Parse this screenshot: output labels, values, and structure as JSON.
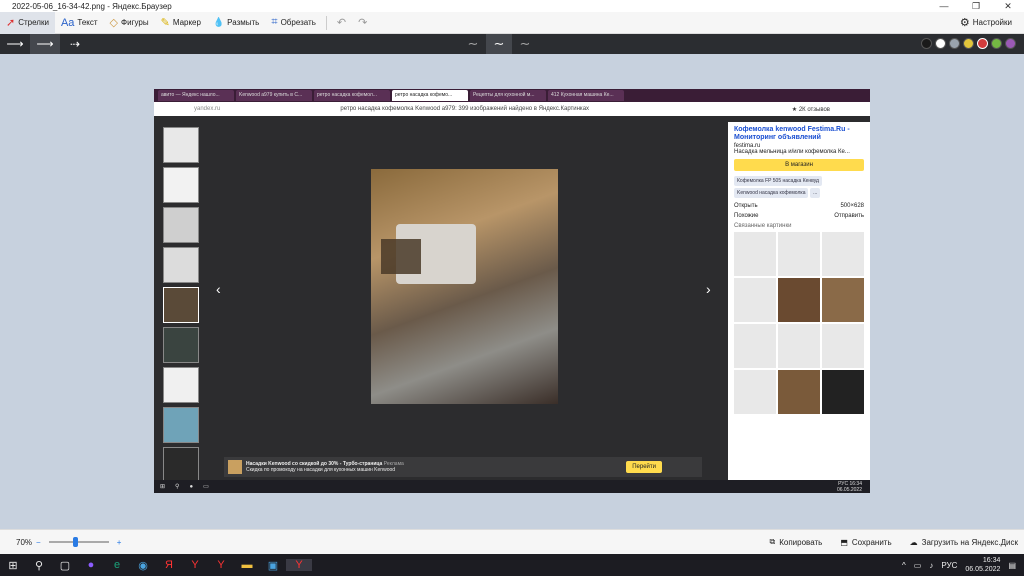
{
  "window": {
    "title": "2022-05-06_16-34-42.png - Яндекс.Браузер",
    "minimize_icon": "—",
    "maximize_icon": "❐",
    "close_icon": "✕"
  },
  "toolbar": {
    "tools": [
      {
        "label": "Стрелки",
        "icon": "➚"
      },
      {
        "label": "Текст",
        "icon": "Aa"
      },
      {
        "label": "Фигуры",
        "icon": "◇"
      },
      {
        "label": "Маркер",
        "icon": "✎"
      },
      {
        "label": "Размыть",
        "icon": "💧"
      },
      {
        "label": "Обрезать",
        "icon": "⌗"
      }
    ],
    "undo_icon": "↶",
    "redo_icon": "↷",
    "settings_label": "Настройки",
    "settings_icon": "⚙"
  },
  "subbar": {
    "arrow_styles": [
      "⟶",
      "⟶",
      "⇢"
    ],
    "curves": [
      "∼",
      "∼",
      "∼"
    ],
    "colors": [
      "#1a1a1a",
      "#ffffff",
      "#9aa3ad",
      "#e3c63b",
      "#d23c3c",
      "#74b843",
      "#9b59b6"
    ]
  },
  "screenshot": {
    "tabs": [
      "авито — Яндекс нашло...",
      "Kenwood a979 купить в С...",
      "ретро насадка кофемол...",
      "ретро насадка кофемо...",
      "Рецепты для кухонной м...",
      "412 Кухонная машина Ке..."
    ],
    "url": "yandex.ru",
    "page_title": "ретро насадка кофемолка Kenwood a979: 399 изображений найдено в Яндекс.Картинках",
    "reviews": "★ 2К отзывов",
    "side": {
      "title": "Кофемолка kenwood Festima.Ru - Мониторинг объявлений",
      "domain": "festima.ru",
      "desc": "Насадка мельница и/или кофемолка Ке...",
      "shop": "В магазин",
      "chips": [
        "Кофемолка FP 505 насадка Кенвуд",
        "Kenwood насадка кофемолка",
        "..."
      ],
      "open": "Открыть",
      "size": "500×628",
      "similar": "Похожие",
      "send": "Отправить",
      "related": "Связанные картинки"
    },
    "ad": {
      "title": "Насадки Kenwood со скидкой до 30% - Турбо-страница",
      "badge": "Реклама",
      "desc": "Скидка по промокоду на насадки для кухонных машин Kenwood",
      "go": "Перейти"
    },
    "inner_clock": {
      "time": "16:34",
      "date": "06.05.2022",
      "lang": "РУС"
    }
  },
  "bottombar": {
    "zoom": "70%",
    "zoom_fraction": 0.45,
    "minus": "−",
    "plus": "+",
    "copy": "Копировать",
    "save": "Сохранить",
    "upload": "Загрузить на Яндекс.Диск"
  },
  "taskbar": {
    "lang": "РУС",
    "time": "16:34",
    "date": "06.05.2022"
  }
}
